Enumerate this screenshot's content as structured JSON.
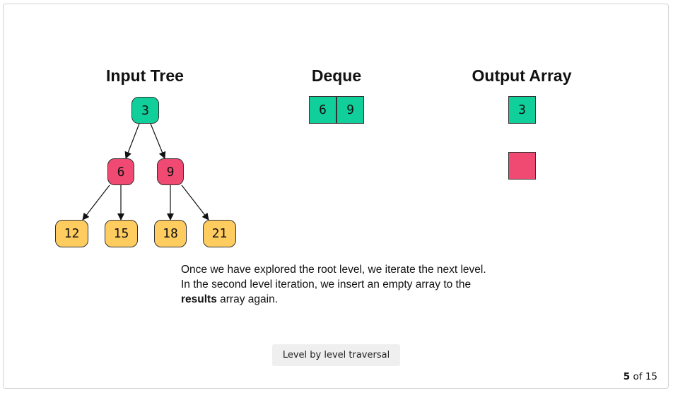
{
  "titles": {
    "input_tree": "Input Tree",
    "deque": "Deque",
    "output_array": "Output Array"
  },
  "tree": {
    "root": "3",
    "level2": [
      "6",
      "9"
    ],
    "level3": [
      "12",
      "15",
      "18",
      "21"
    ]
  },
  "deque": [
    "6",
    "9"
  ],
  "output_array": {
    "row1": [
      "3"
    ],
    "row2": []
  },
  "description": {
    "line1": "Once we have explored the root level, we iterate the next level.",
    "line2": "In the second level iteration, we insert an empty array to the",
    "line3_bold": "results",
    "line3_rest": " array again."
  },
  "caption": "Level by level traversal",
  "pager": {
    "current": "5",
    "separator": "of",
    "total": "15"
  },
  "colors": {
    "visited": "#10cf9a",
    "current_level": "#f04a72",
    "unvisited": "#ffcc60",
    "empty_slot": "#f04a72"
  }
}
